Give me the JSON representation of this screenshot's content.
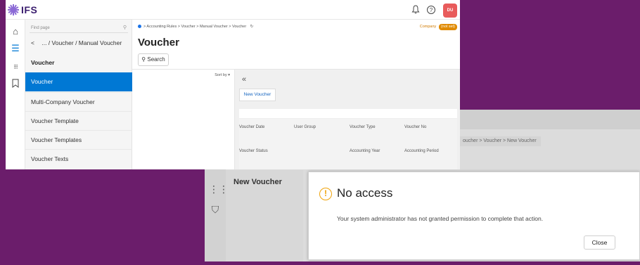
{
  "front": {
    "header": {
      "logo_text": "IFS",
      "icons": [
        "bell-icon",
        "help-icon"
      ],
      "avatar_initials": "DU"
    },
    "rail_icons": [
      "home-icon",
      "menu-icon",
      "apps-grid-icon",
      "bookmark-icon"
    ],
    "nav": {
      "find_placeholder": "Find page",
      "back_label": "... / Voucher / Manual Voucher",
      "section_title": "Voucher",
      "items": [
        {
          "label": "Voucher",
          "active": true
        },
        {
          "label": "Multi-Company Voucher",
          "active": false
        },
        {
          "label": "Voucher Template",
          "active": false
        },
        {
          "label": "Voucher Templates",
          "active": false
        },
        {
          "label": "Voucher Texts",
          "active": false
        }
      ]
    },
    "breadcrumb": "> Accounting Rules > Voucher > Manual Voucher > Voucher",
    "company_label": "Company",
    "company_value": "(not set)",
    "page_title": "Voucher",
    "search_label": "Search",
    "sort_label": "Sort by",
    "new_voucher_label": "New Voucher",
    "fields": {
      "voucher_date": "Voucher Date",
      "user_group": "User Group",
      "voucher_type": "Voucher Type",
      "voucher_no": "Voucher No",
      "voucher_status": "Voucher Status",
      "accounting_year": "Accounting Year",
      "accounting_period": "Accounting Period"
    }
  },
  "back": {
    "breadcrumb": "oucher > Voucher > New Voucher",
    "title": "New Voucher"
  },
  "dialog": {
    "title": "No access",
    "message": "Your system administrator has not granted permission to complete that action.",
    "close_label": "Close",
    "accent_color": "#f0a30a"
  }
}
